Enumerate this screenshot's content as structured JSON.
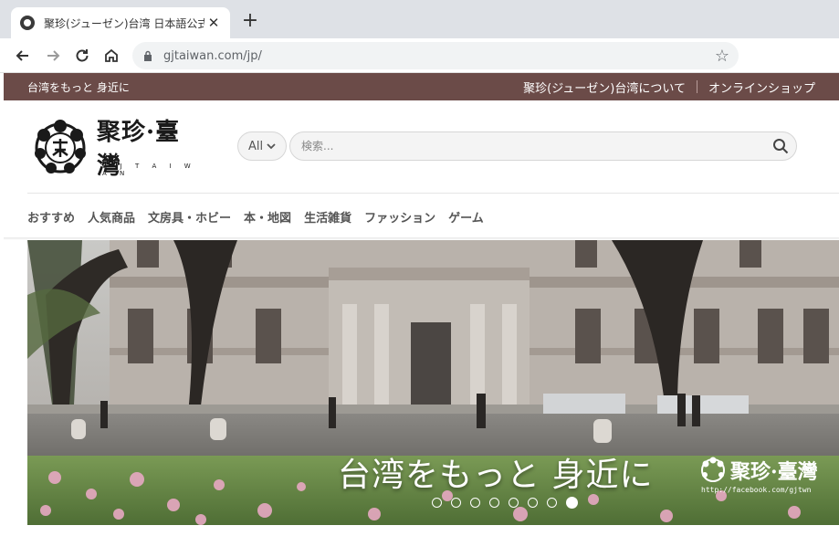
{
  "browser": {
    "tab_title": "聚珍(ジューゼン)台湾 日本語公式",
    "new_tab_label": "+",
    "close_label": "✕",
    "url": "gjtaiwan.com/jp/"
  },
  "topbar": {
    "tagline": "台湾をもっと 身近に",
    "links": [
      "聚珍(ジューゼン)台湾について",
      "オンラインショップ"
    ]
  },
  "header": {
    "logo_text": "聚珍·臺灣",
    "logo_sub": "G J T A I W A N",
    "search": {
      "category": "All",
      "placeholder": "検索..."
    }
  },
  "category_nav": [
    "おすすめ",
    "人気商品",
    "文房具・ホビー",
    "本・地図",
    "生活雑貨",
    "ファッション",
    "ゲーム"
  ],
  "hero": {
    "caption": "台湾をもっと  身近に",
    "logo_text": "聚珍·臺灣",
    "logo_url": "http://facebook.com/gjtwn",
    "slide_count": 8,
    "active_slide": 8
  },
  "colors": {
    "topbar": "#6b4b48",
    "accent_text": "#555555"
  }
}
